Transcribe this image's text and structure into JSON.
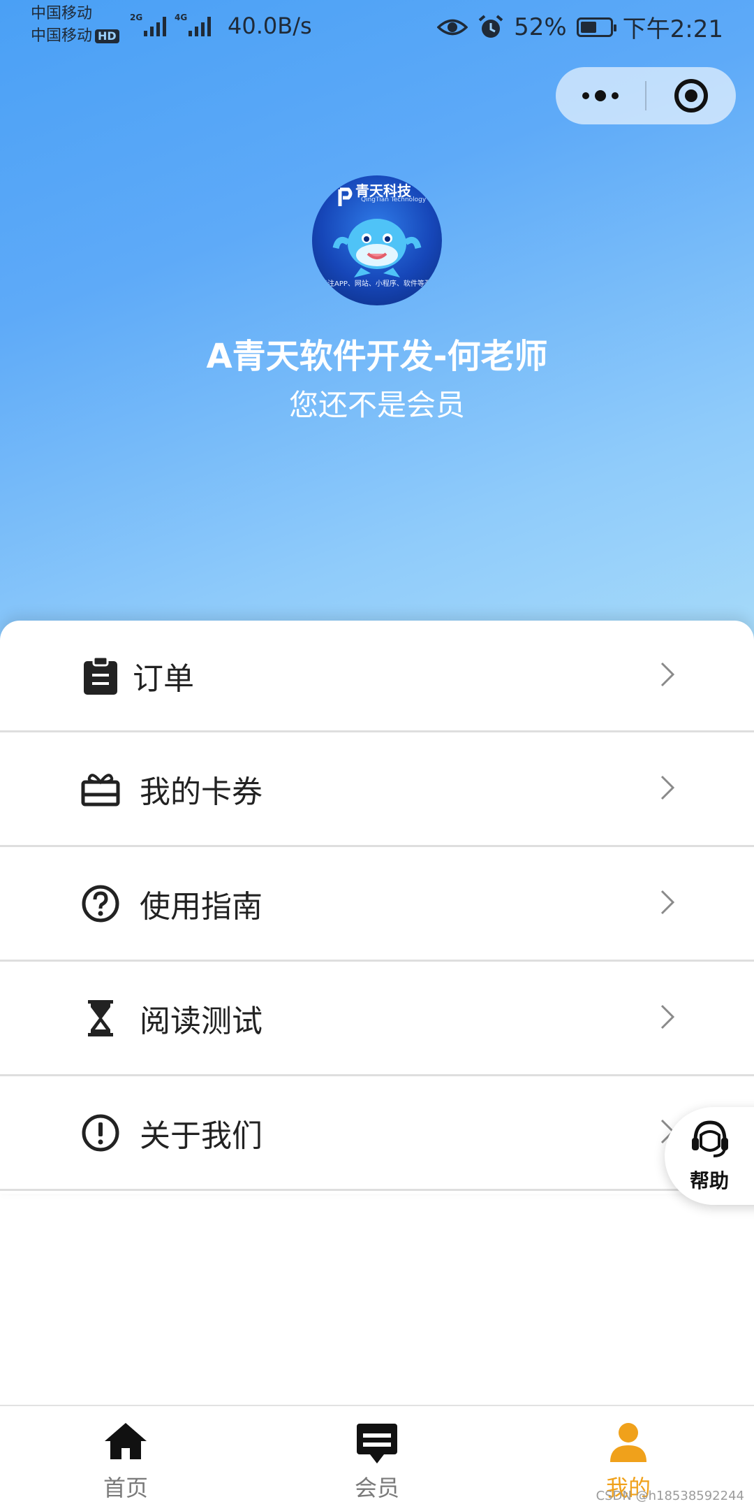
{
  "status_bar": {
    "carrier_1": "中国移动",
    "carrier_2": "中国移动",
    "hd_badge": "HD",
    "net_1": "2G",
    "net_2": "4G",
    "speed": "40.0B/s",
    "battery": "52%",
    "time": "下午2:21",
    "battery_level": 0.52
  },
  "capsule": {
    "more_icon": "more-dots-icon",
    "close_icon": "target-circle-icon"
  },
  "profile": {
    "avatar_logo_text": "青天科技",
    "avatar_logo_sub": "QingTian Technology",
    "avatar_slogan": "专注APP、网站、小程序、软件等开发",
    "name": "A青天软件开发-何老师",
    "membership_status": "您还不是会员"
  },
  "menu": [
    {
      "label": "订单",
      "icon": "clipboard-icon"
    },
    {
      "label": "我的卡券",
      "icon": "gift-card-icon"
    },
    {
      "label": "使用指南",
      "icon": "question-circle-icon"
    },
    {
      "label": "阅读测试",
      "icon": "hourglass-icon"
    },
    {
      "label": "关于我们",
      "icon": "exclamation-circle-icon"
    }
  ],
  "help": {
    "label": "帮助",
    "icon": "headset-icon"
  },
  "tabbar": {
    "items": [
      {
        "label": "首页",
        "icon": "home-icon",
        "active": false
      },
      {
        "label": "会员",
        "icon": "member-card-icon",
        "active": false
      },
      {
        "label": "我的",
        "icon": "user-icon",
        "active": true
      }
    ],
    "active_color": "#f0a11b",
    "inactive_color": "#7a7a7a"
  },
  "watermark": "CSDN @h18538592244",
  "colors": {
    "hero_top": "#4aa0f5",
    "hero_bottom": "#a6daf9"
  }
}
